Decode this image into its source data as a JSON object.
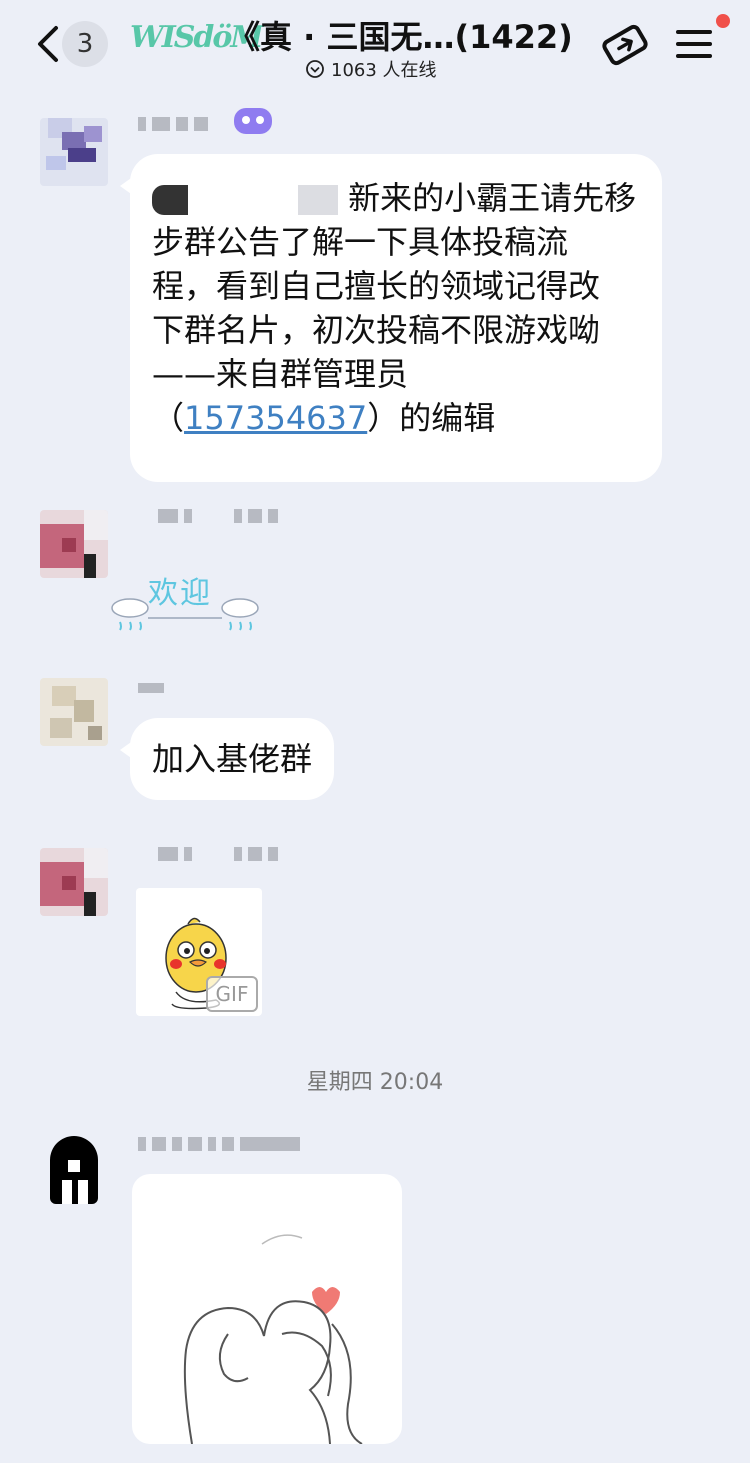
{
  "header": {
    "back_count": "3",
    "brand_text": "WISdöM",
    "title": "《真 · 三国无…(1422)",
    "online_text": "1063 人在线"
  },
  "messages": [
    {
      "sender": "admin-bot",
      "text_lines": [
        "新来的小霸王请先移",
        "步群公告了解一下具体投稿流",
        "程，看到自己擅长的领域记得改",
        "下群名片，初次投稿不限游戏呦",
        "——来自群管理员"
      ],
      "editor_prefix": "（",
      "editor_link": "157354637",
      "editor_suffix": "）的编辑"
    },
    {
      "sender": "member-a",
      "sticker_text": "欢迎"
    },
    {
      "sender": "member-b",
      "text": "加入基佬群"
    },
    {
      "sender": "member-a",
      "gif_badge": "GIF"
    },
    {
      "sender": "member-c",
      "image": "drawing"
    }
  ],
  "timestamp": "星期四 20:04",
  "colors": {
    "background": "#eceff7",
    "bubble": "#ffffff",
    "link": "#3f80c2",
    "sticker_text": "#5ec6e0",
    "notification_dot": "#f0504a",
    "bot_badge": "#8f7cf0"
  }
}
